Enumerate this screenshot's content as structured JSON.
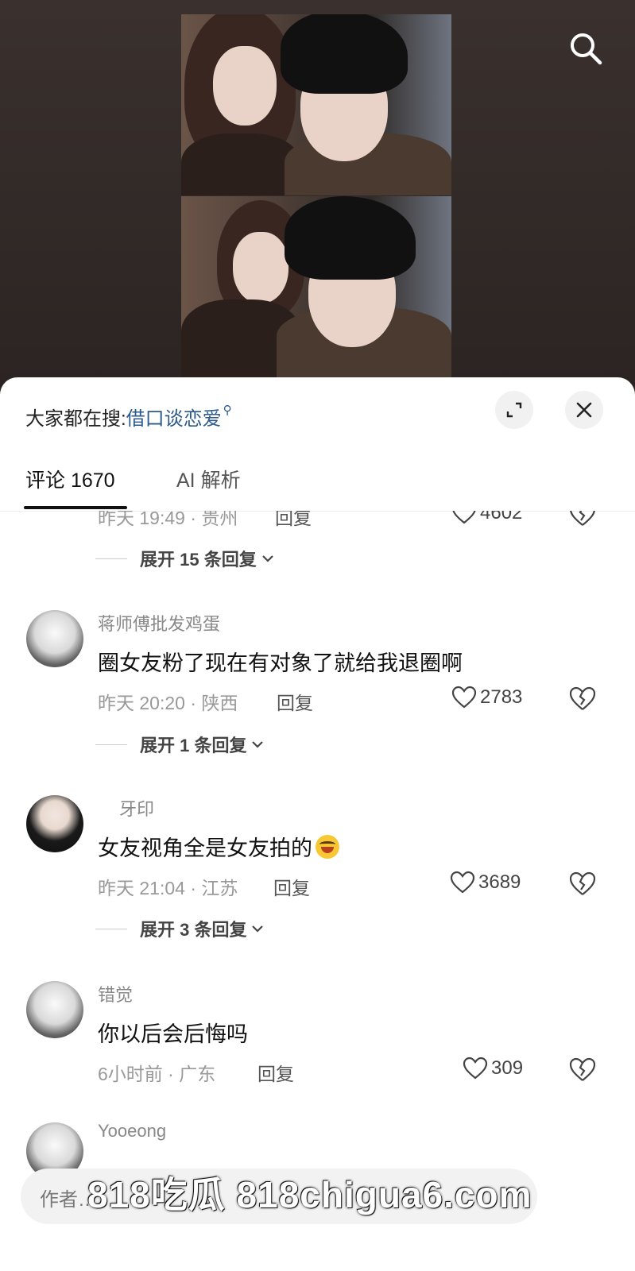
{
  "search_bar": {
    "prefix": "大家都在搜:",
    "keyword": "借口谈恋爱"
  },
  "tabs": [
    {
      "label": "评论 1670",
      "active": true
    },
    {
      "label": "AI 解析",
      "active": false
    }
  ],
  "partial_row": {
    "meta": "昨天 19:49 · 贵州",
    "reply": "回复",
    "likes": "4602",
    "expand": "展开 15 条回复"
  },
  "comments": [
    {
      "name": "蒋师傅批发鸡蛋",
      "text": "圈女友粉了现在有对象了就给我退圈啊",
      "meta": "昨天 20:20 · 陕西",
      "reply": "回复",
      "likes": "2783",
      "expand": "展开 1 条回复"
    },
    {
      "name": "牙印",
      "text": "女友视角全是女友拍的",
      "emoji": "laughing-crying-emoji",
      "meta": "昨天 21:04 · 江苏",
      "reply": "回复",
      "likes": "3689",
      "expand": "展开 3 条回复"
    },
    {
      "name": "错觉",
      "text": "你以后会后悔吗",
      "meta": "6小时前 · 广东",
      "reply": "回复",
      "likes": "309"
    },
    {
      "name": "Yooeong"
    }
  ],
  "input": {
    "placeholder": "作者…"
  },
  "watermark": "818吃瓜  818chigua6.com",
  "colors": {
    "keyword": "#2c5a8c",
    "panel": "#ffffff",
    "video_bg": "#2a2422"
  }
}
